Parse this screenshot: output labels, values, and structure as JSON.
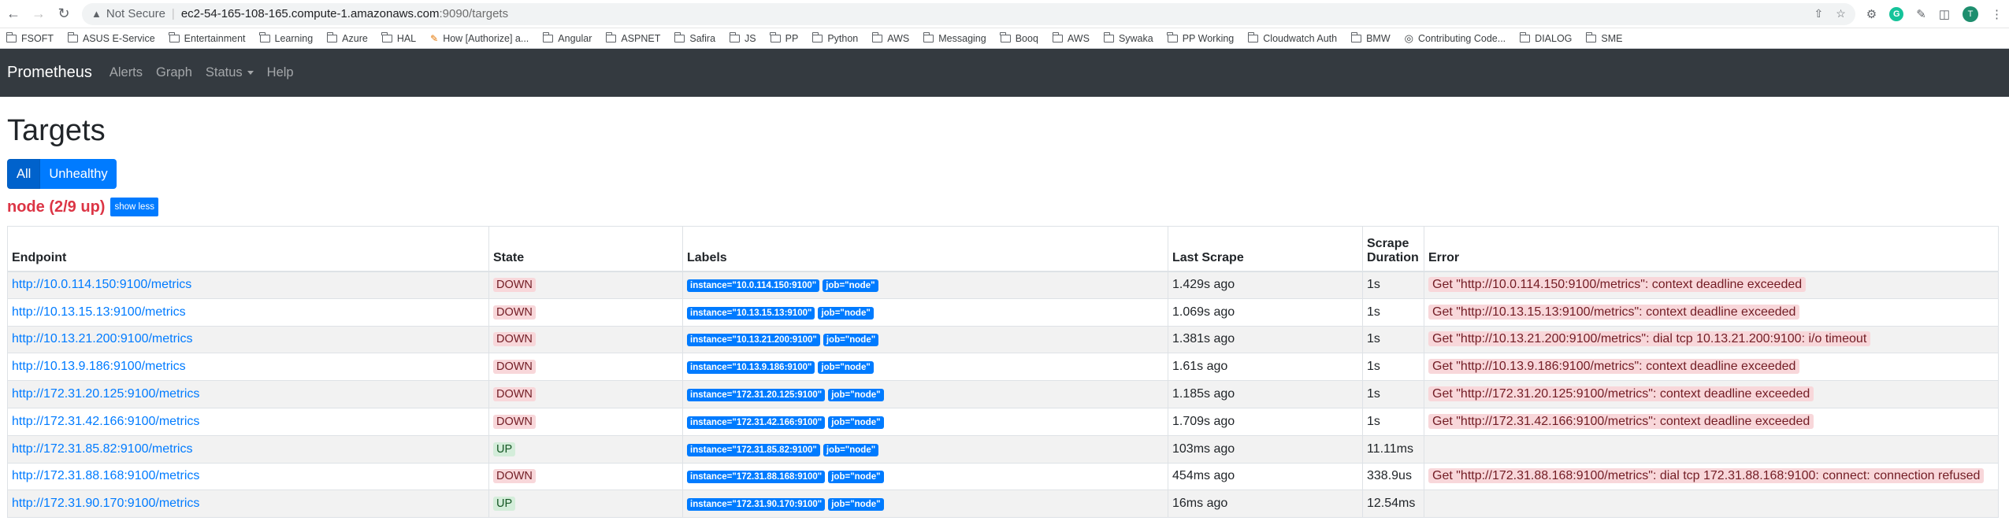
{
  "browser": {
    "security": "Not Secure",
    "host": "ec2-54-165-108-165.compute-1.amazonaws.com",
    "path": ":9090/targets",
    "profile_initial": "T",
    "bookmarks": [
      {
        "label": "FSOFT",
        "icon": "folder-icon"
      },
      {
        "label": "ASUS E-Service",
        "icon": "folder-icon"
      },
      {
        "label": "Entertainment",
        "icon": "folder-icon"
      },
      {
        "label": "Learning",
        "icon": "folder-icon"
      },
      {
        "label": "Azure",
        "icon": "folder-icon"
      },
      {
        "label": "HAL",
        "icon": "folder-icon"
      },
      {
        "label": "How [Authorize] a...",
        "icon": "page-icon"
      },
      {
        "label": "Angular",
        "icon": "folder-icon"
      },
      {
        "label": "ASPNET",
        "icon": "folder-icon"
      },
      {
        "label": "Safira",
        "icon": "folder-icon"
      },
      {
        "label": "JS",
        "icon": "folder-icon"
      },
      {
        "label": "PP",
        "icon": "folder-icon"
      },
      {
        "label": "Python",
        "icon": "folder-icon"
      },
      {
        "label": "AWS",
        "icon": "folder-icon"
      },
      {
        "label": "Messaging",
        "icon": "folder-icon"
      },
      {
        "label": "Booq",
        "icon": "folder-icon"
      },
      {
        "label": "AWS",
        "icon": "folder-icon"
      },
      {
        "label": "Sywaka",
        "icon": "folder-icon"
      },
      {
        "label": "PP Working",
        "icon": "folder-icon"
      },
      {
        "label": "Cloudwatch Auth",
        "icon": "folder-icon"
      },
      {
        "label": "BMW",
        "icon": "folder-icon"
      },
      {
        "label": "Contributing Code...",
        "icon": "globe-icon"
      },
      {
        "label": "DIALOG",
        "icon": "folder-icon"
      },
      {
        "label": "SME",
        "icon": "folder-icon"
      }
    ]
  },
  "nav": {
    "brand": "Prometheus",
    "alerts": "Alerts",
    "graph": "Graph",
    "status": "Status",
    "help": "Help"
  },
  "page": {
    "title": "Targets",
    "filter_all": "All",
    "filter_unhealthy": "Unhealthy",
    "pool_name": "node (2/9 up)",
    "show_less": "show less"
  },
  "table": {
    "headers": {
      "endpoint": "Endpoint",
      "state": "State",
      "labels": "Labels",
      "last_scrape": "Last Scrape",
      "scrape_duration_1": "Scrape",
      "scrape_duration_2": "Duration",
      "error": "Error"
    },
    "rows": [
      {
        "endpoint": "http://10.0.114.150:9100/metrics",
        "state": "DOWN",
        "instance": "instance=\"10.0.114.150:9100\"",
        "job": "job=\"node\"",
        "last_scrape": "1.429s ago",
        "duration": "1s",
        "error": "Get \"http://10.0.114.150:9100/metrics\": context deadline exceeded"
      },
      {
        "endpoint": "http://10.13.15.13:9100/metrics",
        "state": "DOWN",
        "instance": "instance=\"10.13.15.13:9100\"",
        "job": "job=\"node\"",
        "last_scrape": "1.069s ago",
        "duration": "1s",
        "error": "Get \"http://10.13.15.13:9100/metrics\": context deadline exceeded"
      },
      {
        "endpoint": "http://10.13.21.200:9100/metrics",
        "state": "DOWN",
        "instance": "instance=\"10.13.21.200:9100\"",
        "job": "job=\"node\"",
        "last_scrape": "1.381s ago",
        "duration": "1s",
        "error": "Get \"http://10.13.21.200:9100/metrics\": dial tcp 10.13.21.200:9100: i/o timeout"
      },
      {
        "endpoint": "http://10.13.9.186:9100/metrics",
        "state": "DOWN",
        "instance": "instance=\"10.13.9.186:9100\"",
        "job": "job=\"node\"",
        "last_scrape": "1.61s ago",
        "duration": "1s",
        "error": "Get \"http://10.13.9.186:9100/metrics\": context deadline exceeded"
      },
      {
        "endpoint": "http://172.31.20.125:9100/metrics",
        "state": "DOWN",
        "instance": "instance=\"172.31.20.125:9100\"",
        "job": "job=\"node\"",
        "last_scrape": "1.185s ago",
        "duration": "1s",
        "error": "Get \"http://172.31.20.125:9100/metrics\": context deadline exceeded"
      },
      {
        "endpoint": "http://172.31.42.166:9100/metrics",
        "state": "DOWN",
        "instance": "instance=\"172.31.42.166:9100\"",
        "job": "job=\"node\"",
        "last_scrape": "1.709s ago",
        "duration": "1s",
        "error": "Get \"http://172.31.42.166:9100/metrics\": context deadline exceeded"
      },
      {
        "endpoint": "http://172.31.85.82:9100/metrics",
        "state": "UP",
        "instance": "instance=\"172.31.85.82:9100\"",
        "job": "job=\"node\"",
        "last_scrape": "103ms ago",
        "duration": "11.11ms",
        "error": ""
      },
      {
        "endpoint": "http://172.31.88.168:9100/metrics",
        "state": "DOWN",
        "instance": "instance=\"172.31.88.168:9100\"",
        "job": "job=\"node\"",
        "last_scrape": "454ms ago",
        "duration": "338.9us",
        "error": "Get \"http://172.31.88.168:9100/metrics\": dial tcp 172.31.88.168:9100: connect: connection refused"
      },
      {
        "endpoint": "http://172.31.90.170:9100/metrics",
        "state": "UP",
        "instance": "instance=\"172.31.90.170:9100\"",
        "job": "job=\"node\"",
        "last_scrape": "16ms ago",
        "duration": "12.54ms",
        "error": ""
      }
    ]
  }
}
